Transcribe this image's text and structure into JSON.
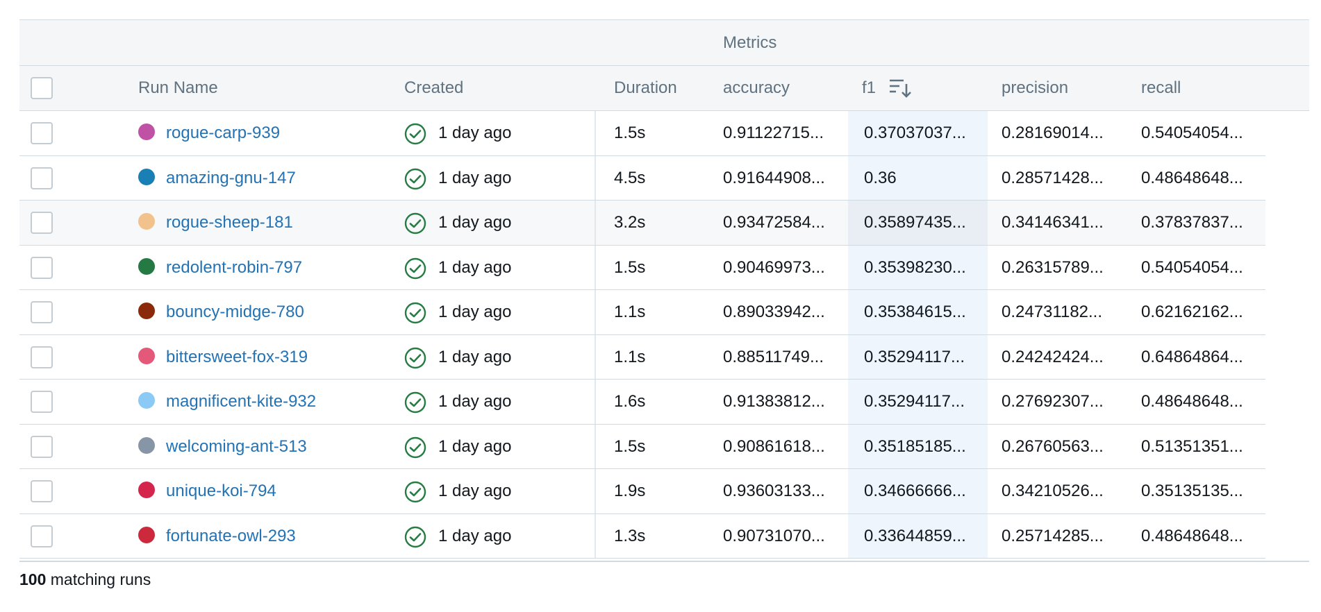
{
  "group_header": "Metrics",
  "columns": {
    "run_name": "Run Name",
    "created": "Created",
    "duration": "Duration",
    "accuracy": "accuracy",
    "f1": "f1",
    "precision": "precision",
    "recall": "recall"
  },
  "sort_icon": "sort-descending-icon",
  "rows": [
    {
      "name": "rogue-carp-939",
      "color": "#c052a6",
      "created": "1 day ago",
      "duration": "1.5s",
      "accuracy": "0.91122715...",
      "f1": "0.37037037...",
      "precision": "0.28169014...",
      "recall": "0.54054054..."
    },
    {
      "name": "amazing-gnu-147",
      "color": "#1a7fb4",
      "created": "1 day ago",
      "duration": "4.5s",
      "accuracy": "0.91644908...",
      "f1": "0.36",
      "precision": "0.28571428...",
      "recall": "0.48648648..."
    },
    {
      "name": "rogue-sheep-181",
      "color": "#f2c28c",
      "created": "1 day ago",
      "duration": "3.2s",
      "accuracy": "0.93472584...",
      "f1": "0.35897435...",
      "precision": "0.34146341...",
      "recall": "0.37837837..."
    },
    {
      "name": "redolent-robin-797",
      "color": "#257a43",
      "created": "1 day ago",
      "duration": "1.5s",
      "accuracy": "0.90469973...",
      "f1": "0.35398230...",
      "precision": "0.26315789...",
      "recall": "0.54054054..."
    },
    {
      "name": "bouncy-midge-780",
      "color": "#8a2a0b",
      "created": "1 day ago",
      "duration": "1.1s",
      "accuracy": "0.89033942...",
      "f1": "0.35384615...",
      "precision": "0.24731182...",
      "recall": "0.62162162..."
    },
    {
      "name": "bittersweet-fox-319",
      "color": "#e4587a",
      "created": "1 day ago",
      "duration": "1.1s",
      "accuracy": "0.88511749...",
      "f1": "0.35294117...",
      "precision": "0.24242424...",
      "recall": "0.64864864..."
    },
    {
      "name": "magnificent-kite-932",
      "color": "#8ccaf6",
      "created": "1 day ago",
      "duration": "1.6s",
      "accuracy": "0.91383812...",
      "f1": "0.35294117...",
      "precision": "0.27692307...",
      "recall": "0.48648648..."
    },
    {
      "name": "welcoming-ant-513",
      "color": "#8796a6",
      "created": "1 day ago",
      "duration": "1.5s",
      "accuracy": "0.90861618...",
      "f1": "0.35185185...",
      "precision": "0.26760563...",
      "recall": "0.51351351..."
    },
    {
      "name": "unique-koi-794",
      "color": "#d4264c",
      "created": "1 day ago",
      "duration": "1.9s",
      "accuracy": "0.93603133...",
      "f1": "0.34666666...",
      "precision": "0.34210526...",
      "recall": "0.35135135..."
    },
    {
      "name": "fortunate-owl-293",
      "color": "#cc2a3c",
      "created": "1 day ago",
      "duration": "1.3s",
      "accuracy": "0.90731070...",
      "f1": "0.33644859...",
      "precision": "0.25714285...",
      "recall": "0.48648648..."
    }
  ],
  "hover_row_index": 2,
  "footer": {
    "count": "100",
    "label": " matching runs"
  },
  "colors": {
    "link": "#2272b4",
    "success": "#277c43",
    "header_text": "#5f7281",
    "sorted_column_bg": "#eef5fc"
  }
}
